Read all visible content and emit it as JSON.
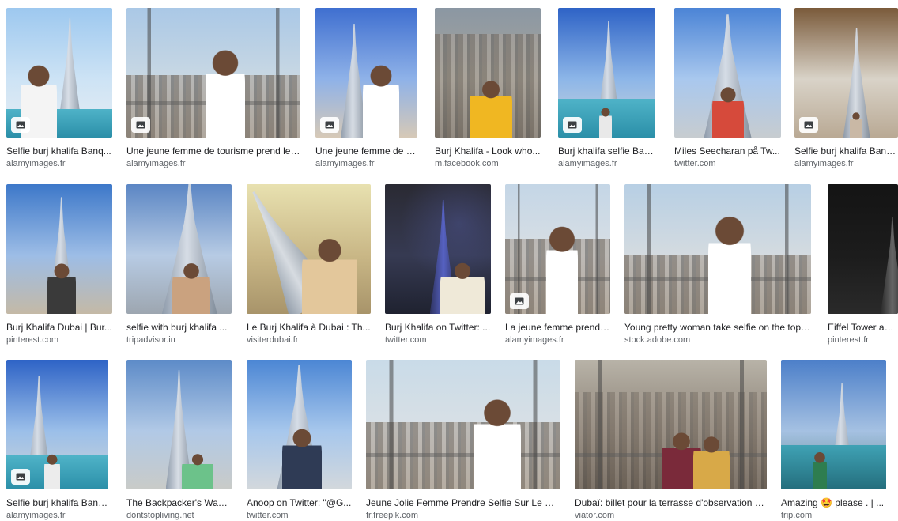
{
  "results": [
    {
      "title": "Selfie burj khalifa Banq...",
      "source": "alamyimages.fr"
    },
    {
      "title": "Une jeune femme de tourisme prend le p...",
      "source": "alamyimages.fr"
    },
    {
      "title": "Une jeune femme de to...",
      "source": "alamyimages.fr"
    },
    {
      "title": "Burj Khalifa - Look who...",
      "source": "m.facebook.com"
    },
    {
      "title": "Burj khalifa selfie Banq...",
      "source": "alamyimages.fr"
    },
    {
      "title": "Miles Seecharan på Tw...",
      "source": "twitter.com"
    },
    {
      "title": "Selfie burj khalifa Banq...",
      "source": "alamyimages.fr"
    },
    {
      "title": "Burj Khalifa Dubai | Bur...",
      "source": "pinterest.com"
    },
    {
      "title": "selfie with burj khalifa ...",
      "source": "tripadvisor.in"
    },
    {
      "title": "Le Burj Khalifa à Dubai : Th...",
      "source": "visiterdubai.fr"
    },
    {
      "title": "Burj Khalifa on Twitter: ...",
      "source": "twitter.com"
    },
    {
      "title": "La jeune femme prend ...",
      "source": "alamyimages.fr"
    },
    {
      "title": "Young pretty woman take selfie on the top ...",
      "source": "stock.adobe.com"
    },
    {
      "title": "Eiffel Tower and B",
      "source": "pinterest.fr"
    },
    {
      "title": "Selfie burj khalifa Banq...",
      "source": "alamyimages.fr"
    },
    {
      "title": "The Backpacker's Way ...",
      "source": "dontstopliving.net"
    },
    {
      "title": "Anoop on Twitter: \"@G...",
      "source": "twitter.com"
    },
    {
      "title": "Jeune Jolie Femme Prendre Selfie Sur Le Des...",
      "source": "fr.freepik.com"
    },
    {
      "title": "Dubaï: billet pour la terrasse d'observation d...",
      "source": "viator.com"
    },
    {
      "title": "Amazing 🤩 please . | ...",
      "source": "trip.com"
    }
  ],
  "badge_icon": "image-icon",
  "emoji_icon": "star-struck-emoji-icon"
}
